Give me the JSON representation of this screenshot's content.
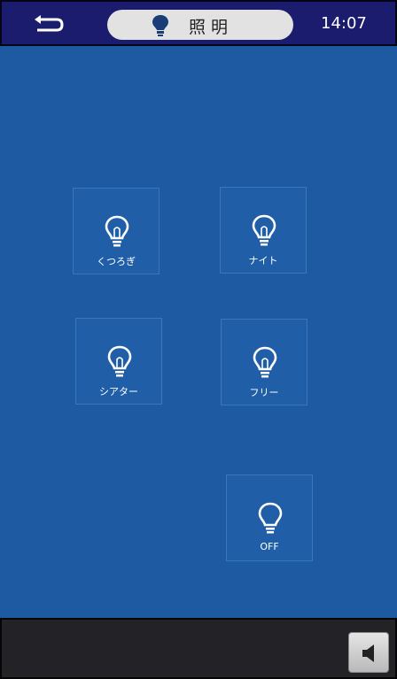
{
  "header": {
    "back_icon": "back-arrow-icon",
    "title": "照明",
    "title_icon": "lightbulb-icon",
    "time": "14:07"
  },
  "scenes": [
    {
      "label": "くつろぎ",
      "icon": "lightbulb-icon"
    },
    {
      "label": "ナイト",
      "icon": "lightbulb-icon"
    },
    {
      "label": "シアター",
      "icon": "lightbulb-icon"
    },
    {
      "label": "フリー",
      "icon": "lightbulb-icon"
    },
    {
      "label": "OFF",
      "icon": "lightbulb-icon"
    }
  ],
  "footer": {
    "volume_icon": "speaker-icon"
  },
  "colors": {
    "header_bg": "#1c1c6e",
    "main_bg": "#1e5aa2",
    "footer_bg": "#232327",
    "pill_bg": "#e2e2e2"
  }
}
